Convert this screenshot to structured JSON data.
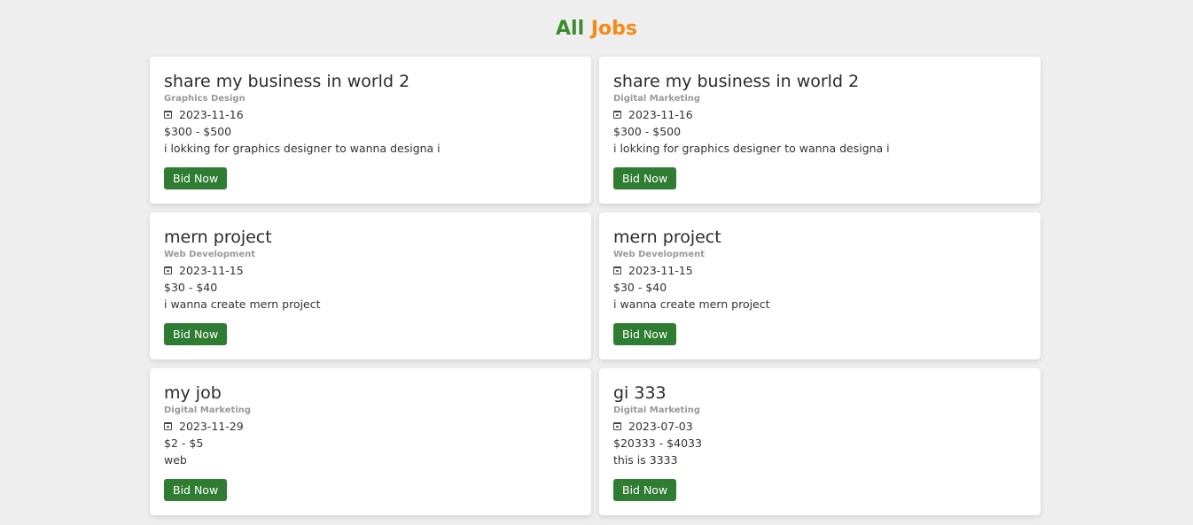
{
  "header": {
    "title_part1": "All",
    "title_part2": "Jobs"
  },
  "colors": {
    "accent_green": "#3a8a2e",
    "accent_orange": "#f58a14",
    "button_green": "#2e7d32"
  },
  "jobs": [
    {
      "title": "share my business in world 2",
      "category": "Graphics Design",
      "date": "2023-11-16",
      "price": "$300 - $500",
      "description": "i lokking for graphics designer to wanna designa i",
      "button_label": "Bid Now"
    },
    {
      "title": "share my business in world 2",
      "category": "Digital Marketing",
      "date": "2023-11-16",
      "price": "$300 - $500",
      "description": "i lokking for graphics designer to wanna designa i",
      "button_label": "Bid Now"
    },
    {
      "title": "mern project",
      "category": "Web Development",
      "date": "2023-11-15",
      "price": "$30 - $40",
      "description": "i wanna create mern project",
      "button_label": "Bid Now"
    },
    {
      "title": "mern project",
      "category": "Web Development",
      "date": "2023-11-15",
      "price": "$30 - $40",
      "description": "i wanna create mern project",
      "button_label": "Bid Now"
    },
    {
      "title": "my job",
      "category": "Digital Marketing",
      "date": "2023-11-29",
      "price": "$2 - $5",
      "description": "web",
      "button_label": "Bid Now"
    },
    {
      "title": "gi 333",
      "category": "Digital Marketing",
      "date": "2023-07-03",
      "price": "$20333 - $4033",
      "description": "this is 3333",
      "button_label": "Bid Now"
    }
  ]
}
